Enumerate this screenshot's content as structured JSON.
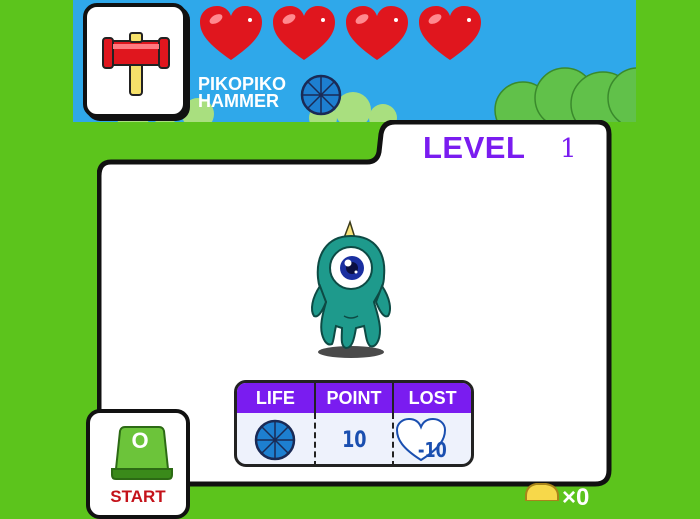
{
  "hud": {
    "hearts": 4,
    "weapon_name_line1": "PIKOPIKO",
    "weapon_name_line2": "HAMMER"
  },
  "level": {
    "label": "LEVEL",
    "value": "1"
  },
  "stats": {
    "life_label": "LIFE",
    "point_label": "POINT",
    "lost_label": "LOST",
    "point_value": "10",
    "lost_value": "-10"
  },
  "start": {
    "key": "O",
    "label": "START"
  },
  "coins": {
    "count": "×0"
  },
  "colors": {
    "background_green": "#5cc41c",
    "sky_blue": "#2fa8ea",
    "accent_purple": "#7a1cf0",
    "heart_red": "#e0161e",
    "start_red": "#c4121a"
  },
  "icons": [
    "hammer-icon",
    "heart-icon",
    "life-wheel-icon",
    "monster-sprite",
    "keyboard-key-icon",
    "coin-icon"
  ]
}
